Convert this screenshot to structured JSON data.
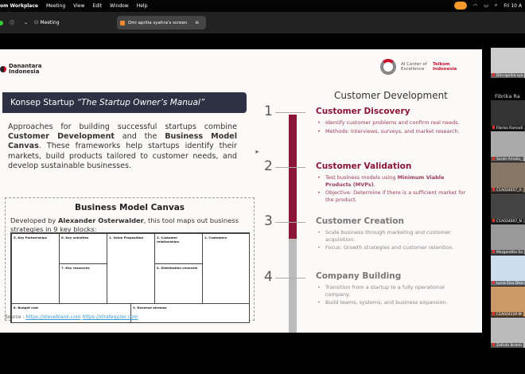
{
  "menubar": {
    "app": "om Workplace",
    "items": [
      "Meeting",
      "View",
      "Edit",
      "Window",
      "Help"
    ],
    "clock": "Fri 10 A"
  },
  "toolbar": {
    "meeting_label": "Meeting",
    "share_label": "Dini aprilia syahra's screen"
  },
  "slide": {
    "logo_left": [
      "Danantara",
      "Indonesia"
    ],
    "logo_right": {
      "ai": "AI Center of Excellence",
      "telkom": "Telkom Indonesia"
    },
    "banner": {
      "prefix": "Konsep Startup ",
      "italic": "“The Startup Owner’s Manual”"
    },
    "intro": {
      "t1": "Approaches for building successful startups combine ",
      "b1": "Customer Development",
      "t2": " and the ",
      "b2": "Business Model Canvas",
      "t3": ". These frameworks help startups identify their markets, build products tailored to customer needs, and develop sustainable businesses."
    },
    "bmc": {
      "title": "Business Model Canvas",
      "t1": "Developed by ",
      "author": "Alexander Osterwalder",
      "t2": ", this tool maps out business strategies in 9 key blocks:",
      "cells": [
        "5. Key Partnerships",
        "6. Key activities",
        "7. Key resources",
        "1. Value Proposition",
        "3. Customer relationships",
        "4. Distribution channels",
        "2. Customers",
        "8. Budget cost",
        "9. Revenue streams"
      ]
    },
    "source": {
      "label": "Source : ",
      "link1": "https://steveblank.com",
      "link2": "https://strategyzer.com"
    },
    "cd": {
      "title": "Customer Development",
      "progress_stages_complete": 2,
      "stages": [
        {
          "num": "1",
          "title": "Customer Discovery",
          "bullets": [
            "Identify customer problems and confirm real needs.",
            "Methods: Interviews, surveys, and market research."
          ]
        },
        {
          "num": "2",
          "title": "Customer Validation",
          "b0a": "Test business models using ",
          "b0b": "Minimum Viable Products (MVPs)",
          "b0c": ".",
          "bullets": [
            "",
            "Objective: Determine if there is a sufficient market for the product."
          ]
        },
        {
          "num": "3",
          "title": "Customer Creation",
          "bullets": [
            "Scale business through marketing and customer acquisition.",
            "Focus: Growth strategies and customer retention."
          ]
        },
        {
          "num": "4",
          "title": "Company Building",
          "bullets": [
            "Transition from a startup to a fully operational company.",
            "Build teams, systems, and business expansion."
          ]
        }
      ]
    }
  },
  "participants": {
    "active_speaker": "Fibrika Ra",
    "tiles": [
      "Dini aprilia sya",
      "Fibrika Ramadi",
      "Sarah Amalia_",
      "C1A024057_A",
      "C1A024007_N",
      "Margaretha Sa",
      "Lusia Elsa Dika D",
      "C1A024119 M",
      "Zafirah Ikrami"
    ]
  },
  "colors": {
    "accent": "#8a1538",
    "banner": "#2c3144",
    "recording": "#f39a2b"
  }
}
